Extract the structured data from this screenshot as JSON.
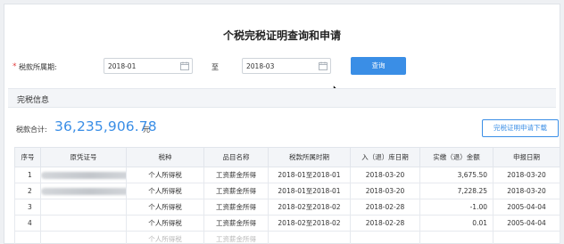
{
  "page": {
    "title": "个税完税证明查询和申请"
  },
  "query": {
    "period_label": "税款所属期:",
    "required_mark": "*",
    "start_value": "2018-01",
    "to_label": "至",
    "end_value": "2018-03",
    "search_button": "查询"
  },
  "section": {
    "title": "完税信息"
  },
  "summary": {
    "total_label": "税款合计:",
    "total_amount": "36,235,906.78",
    "unit": "元",
    "download_button": "完税证明申请下载"
  },
  "table": {
    "headers": [
      "序号",
      "原凭证号",
      "税种",
      "品目名称",
      "税款所属时期",
      "入（退）库日期",
      "实缴（退）金额",
      "申报日期"
    ],
    "rows": [
      {
        "seq": "1",
        "voucher": "",
        "tax": "个人所得税",
        "item": "工资薪金所得",
        "period": "2018-01至2018-01",
        "storage_date": "2018-03-20",
        "amount": "3,675.50",
        "declare_date": "2018-03-20"
      },
      {
        "seq": "2",
        "voucher": "",
        "tax": "个人所得税",
        "item": "工资薪金所得",
        "period": "2018-01至2018-01",
        "storage_date": "2018-03-20",
        "amount": "7,228.25",
        "declare_date": "2018-03-20"
      },
      {
        "seq": "3",
        "voucher": "",
        "tax": "个人所得税",
        "item": "工资薪金所得",
        "period": "2018-02至2018-02",
        "storage_date": "2018-02-28",
        "amount": "-1.00",
        "declare_date": "2005-04-04"
      },
      {
        "seq": "4",
        "voucher": "",
        "tax": "个人所得税",
        "item": "工资薪金所得",
        "period": "2018-02至2018-02",
        "storage_date": "2018-02-28",
        "amount": "0.01",
        "declare_date": "2005-04-04"
      },
      {
        "seq": "",
        "voucher": "",
        "tax": "个人所得税",
        "item": "工资薪金所得",
        "period": "",
        "storage_date": "",
        "amount": "",
        "declare_date": ""
      }
    ]
  }
}
